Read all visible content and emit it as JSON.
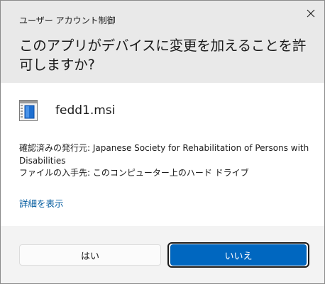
{
  "window": {
    "title": "ユーザー アカウント制御"
  },
  "header": {
    "question": "このアプリがデバイスに変更を加えることを許可しますか?"
  },
  "program": {
    "icon": "installer-package-icon",
    "name": "fedd1.msi",
    "publisher_line": "確認済みの発行元: Japanese Society for Rehabilitation of Persons with Disabilities",
    "origin_line": "ファイルの入手先: このコンピューター上のハード ドライブ",
    "details_link": "詳細を表示"
  },
  "buttons": {
    "yes": "はい",
    "no": "いいえ"
  },
  "colors": {
    "accent": "#0067c0",
    "link": "#005a9e",
    "header_bg": "#e9e9e9",
    "body_bg": "#ffffff"
  }
}
